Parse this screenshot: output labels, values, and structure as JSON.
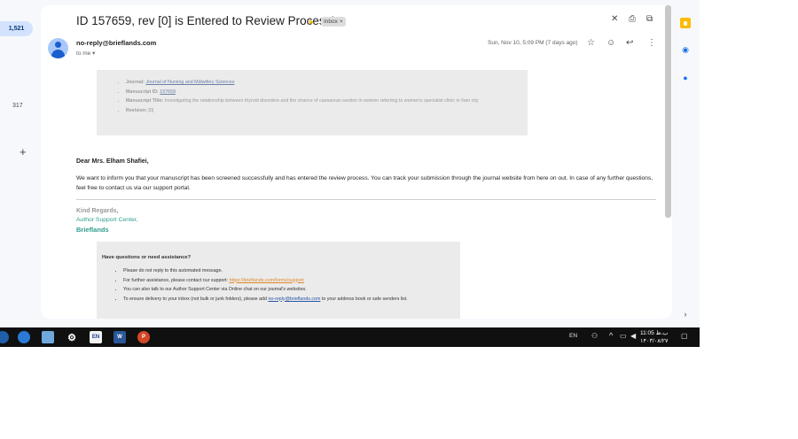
{
  "leftrail": {
    "inbox_count": "1,521",
    "other_count": "317",
    "compose": "+"
  },
  "email": {
    "subject": "ID 157659, rev [0] is Entered to Review Process!",
    "label": "Inbox",
    "label_close": "×",
    "sender": "no-reply@brieflands.com",
    "to": "to me",
    "date": "Sun, Nov 10, 5:09 PM (7 days ago)",
    "info": {
      "journal_key": "Journal:",
      "journal_val": "Journal of Nursing and Midwifery Sciences",
      "id_key": "Manuscript ID:",
      "id_val": "157659",
      "title_key": "Manuscript Title:",
      "title_val": "Investigating the relationship between thyroid disorders and the chance of caesarean section in women referring to women's specialist clinic in Ilam city",
      "rev_key": "Revision:",
      "rev_val": "[0]"
    },
    "greeting": "Dear Mrs. Elham Shafiei,",
    "body": "We want to inform you that your manuscript has been screened successfully and has entered the review process. You can track your submission through the journal website from here on out. In case of any further questions, feel free to contact us via our support portal.",
    "regards": "Kind Regards,",
    "center": "Author Support Center,",
    "brand": "Brieflands",
    "help": {
      "title": "Have questions or need assistance?",
      "item1": "Please do not reply to this automated message.",
      "item2_pre": "For further assistance, please contact our support:",
      "item2_link": "https://brieflands.com/forms/support",
      "item3": "You can also talk to our Author Support Center via Online chat on our journal's websites.",
      "item4_pre": "To ensure delivery to your inbox (not bulk or junk folders), please add",
      "item4_link": "no-reply@brieflands.com",
      "item4_post": "to your address book or safe senders list."
    }
  },
  "taskbar": {
    "lang_app": "EN",
    "word": "W",
    "ppt": "P",
    "tray_lang": "EN",
    "time": "11:05 ب.ظ",
    "date": "۱۴۰۳/۰۸/۲۷"
  },
  "colors": {
    "accent": "#2e9e8c",
    "badge_bg": "#d3e3fd",
    "taskbar": "#101010"
  }
}
